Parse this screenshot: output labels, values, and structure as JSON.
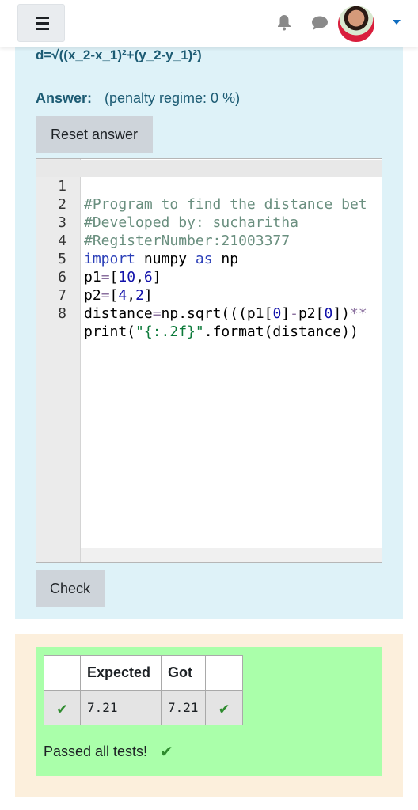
{
  "navbar": {
    "menu_icon": "hamburger-icon",
    "notification_icon": "bell-icon",
    "messages_icon": "chat-icon",
    "avatar_alt": "user-avatar",
    "dropdown_icon": "caret-down-icon",
    "accent": "#0f6cbf"
  },
  "question": {
    "formula": "d=√((x_2-x_1)²+(y_2-y_1)²)",
    "answer_label": "Answer:",
    "penalty": "(penalty regime: 0 %)",
    "reset_label": "Reset answer",
    "check_label": "Check",
    "background": "#def2f8"
  },
  "editor": {
    "lines": [
      {
        "n": "1",
        "code": "#Program to find the distance bet"
      },
      {
        "n": "2",
        "code": "#Developed by: sucharitha"
      },
      {
        "n": "3",
        "code": "#RegisterNumber:21003377"
      },
      {
        "n": "4",
        "code": "import numpy as np"
      },
      {
        "n": "5",
        "code": "p1=[10,6]"
      },
      {
        "n": "6",
        "code": "p2=[4,2]"
      },
      {
        "n": "7",
        "code": "distance=np.sqrt(((p1[0]-p2[0])**"
      },
      {
        "n": "8",
        "code": "print(\"{:.2f}\".format(distance))"
      }
    ]
  },
  "results": {
    "headers": [
      "",
      "Expected",
      "Got",
      ""
    ],
    "rows": [
      {
        "status_icon": "check-icon",
        "expected": "7.21",
        "got": "7.21",
        "result_icon": "check-icon"
      }
    ],
    "summary": "Passed all tests!",
    "summary_icon": "check-icon",
    "pass_color": "#aaffaa"
  }
}
